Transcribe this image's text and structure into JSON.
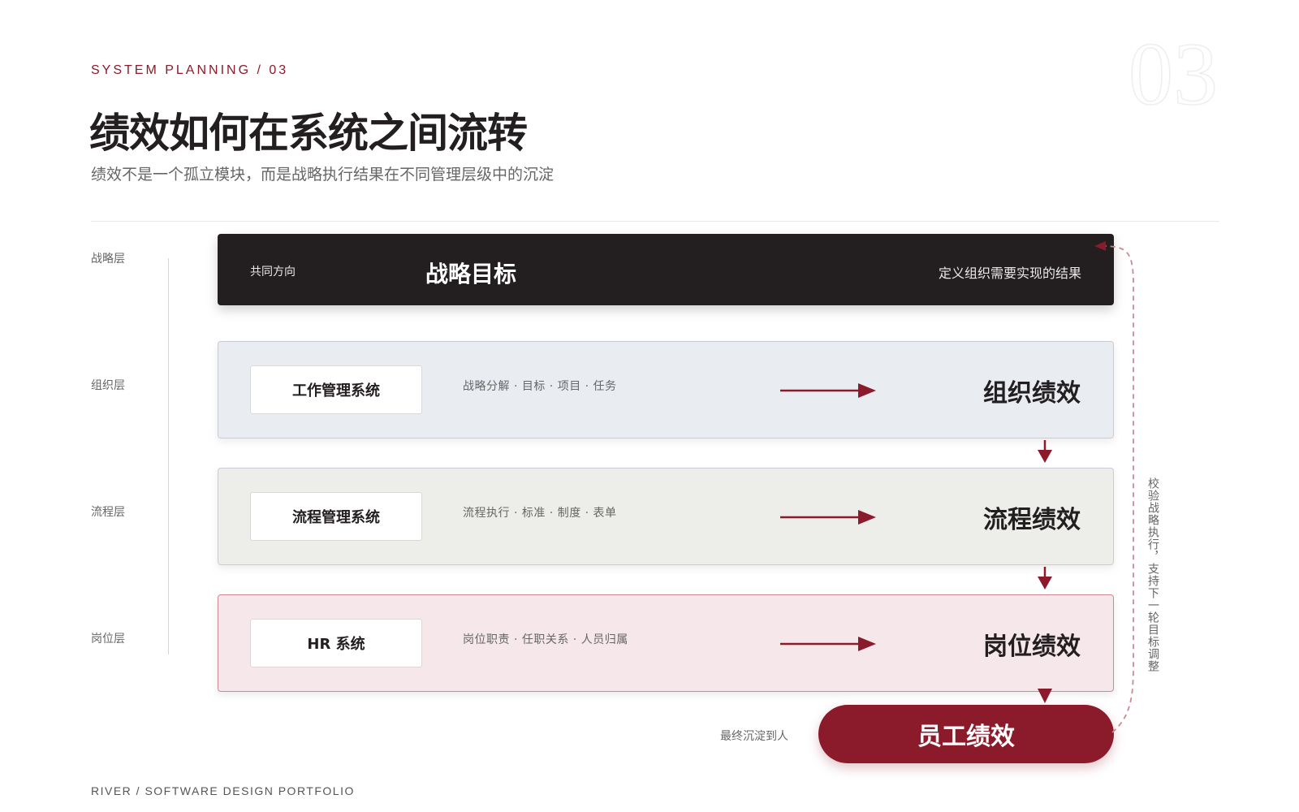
{
  "header": {
    "eyebrow": "SYSTEM PLANNING / 03",
    "big_number": "03",
    "title": "绩效如何在系统之间流转",
    "subtitle": "绩效不是一个孤立模块，而是战略执行结果在不同管理层级中的沉淀"
  },
  "layers": {
    "strategy": "战略层",
    "organization": "组织层",
    "process": "流程层",
    "position": "岗位层"
  },
  "strategy_band": {
    "left_text": "共同方向",
    "center_text": "战略目标",
    "right_text": "定义组织需要实现的结果"
  },
  "bands": [
    {
      "system": "工作管理系统",
      "desc": "战略分解 · 目标 · 项目 · 任务",
      "performance": "组织绩效",
      "bg": "#e9edf2"
    },
    {
      "system": "流程管理系统",
      "desc": "流程执行 · 标准 · 制度 · 表单",
      "performance": "流程绩效",
      "bg": "#edeee9"
    },
    {
      "system": "HR 系统",
      "desc": "岗位职责 · 任职关系 · 人员归属",
      "performance": "岗位绩效",
      "bg": "#f6e8ea"
    }
  ],
  "employee": {
    "note": "最终沉淀到人",
    "label": "员工绩效"
  },
  "feedback": {
    "text": "校验战略执行，支持下一轮目标调整"
  },
  "footer": "RIVER / SOFTWARE DESIGN PORTFOLIO",
  "colors": {
    "accent": "#8b1a2b",
    "dark": "#231f20",
    "muted_text": "#666666"
  }
}
